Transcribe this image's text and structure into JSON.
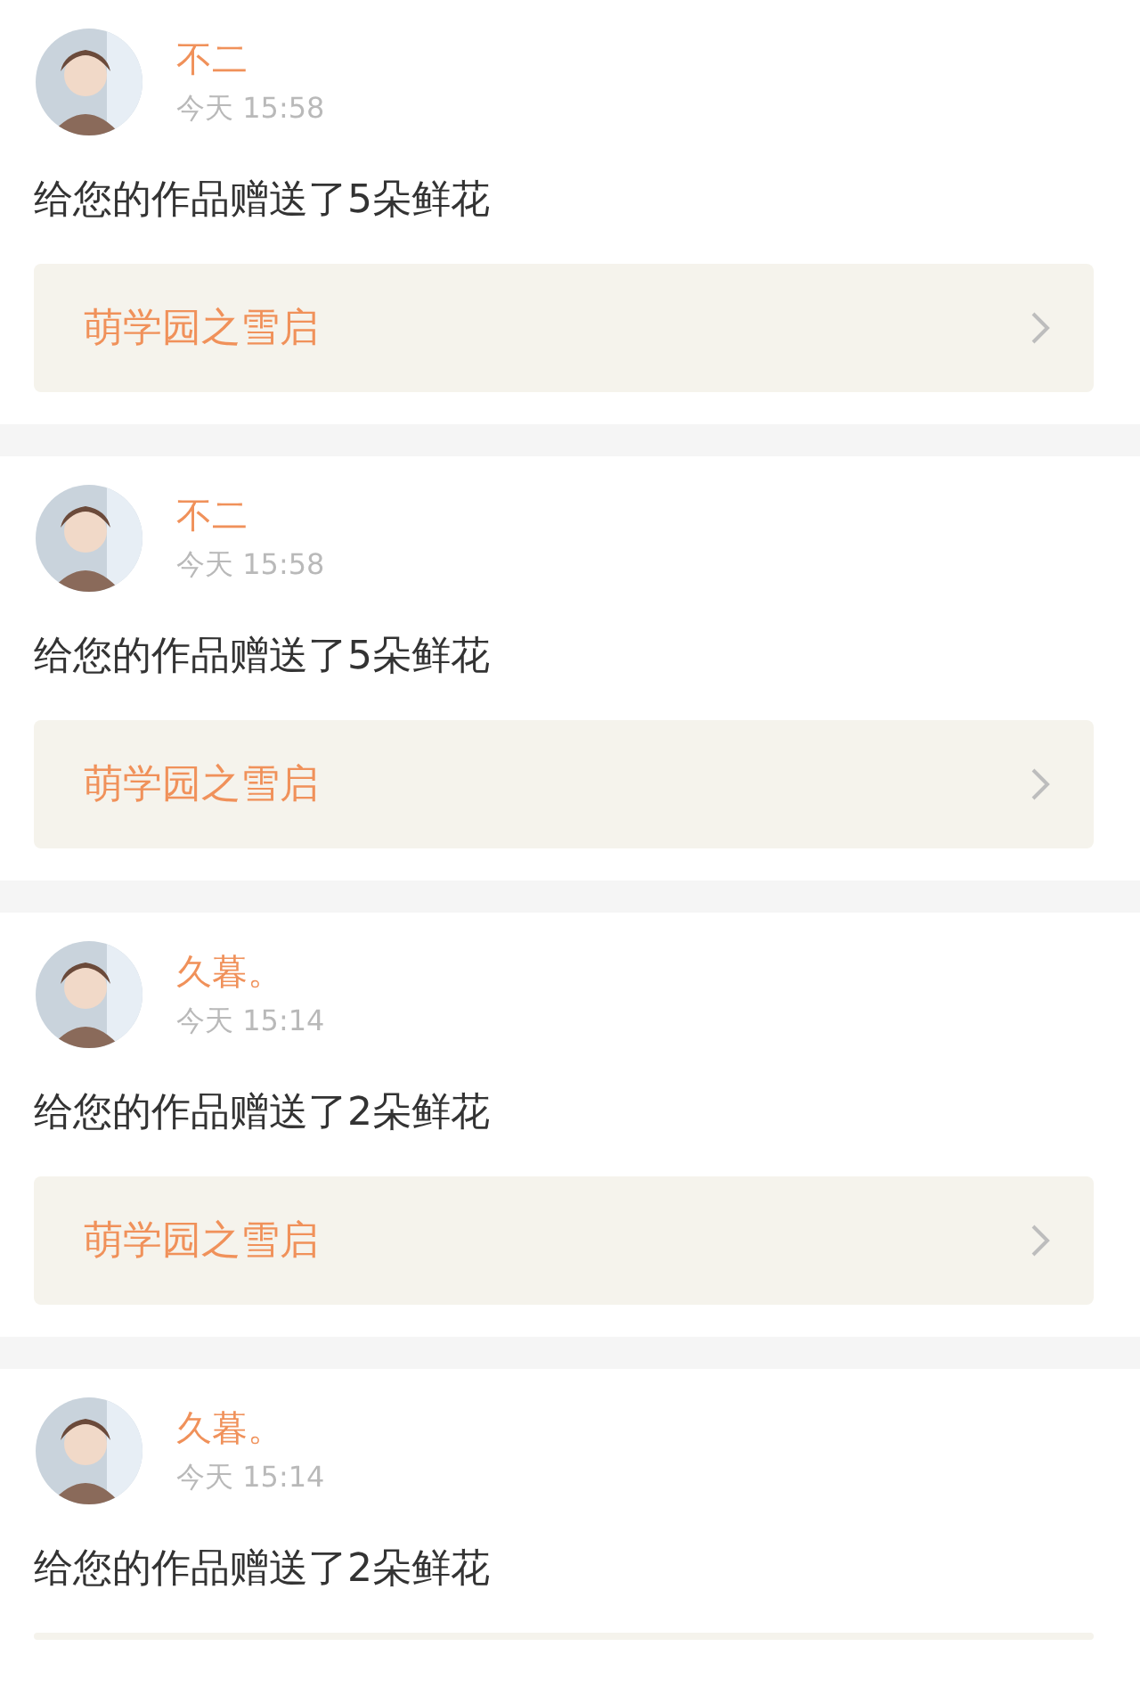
{
  "notifications": [
    {
      "name": "不二",
      "time": "今天 15:58",
      "message": "给您的作品赠送了5朵鲜花",
      "link": {
        "label": "萌学园之雪启"
      }
    },
    {
      "name": "不二",
      "time": "今天 15:58",
      "message": "给您的作品赠送了5朵鲜花",
      "link": {
        "label": "萌学园之雪启"
      }
    },
    {
      "name": "久暮。",
      "time": "今天 15:14",
      "message": "给您的作品赠送了2朵鲜花",
      "link": {
        "label": "萌学园之雪启"
      }
    },
    {
      "name": "久暮。",
      "time": "今天 15:14",
      "message": "给您的作品赠送了2朵鲜花",
      "link": {
        "cut": true
      }
    }
  ]
}
